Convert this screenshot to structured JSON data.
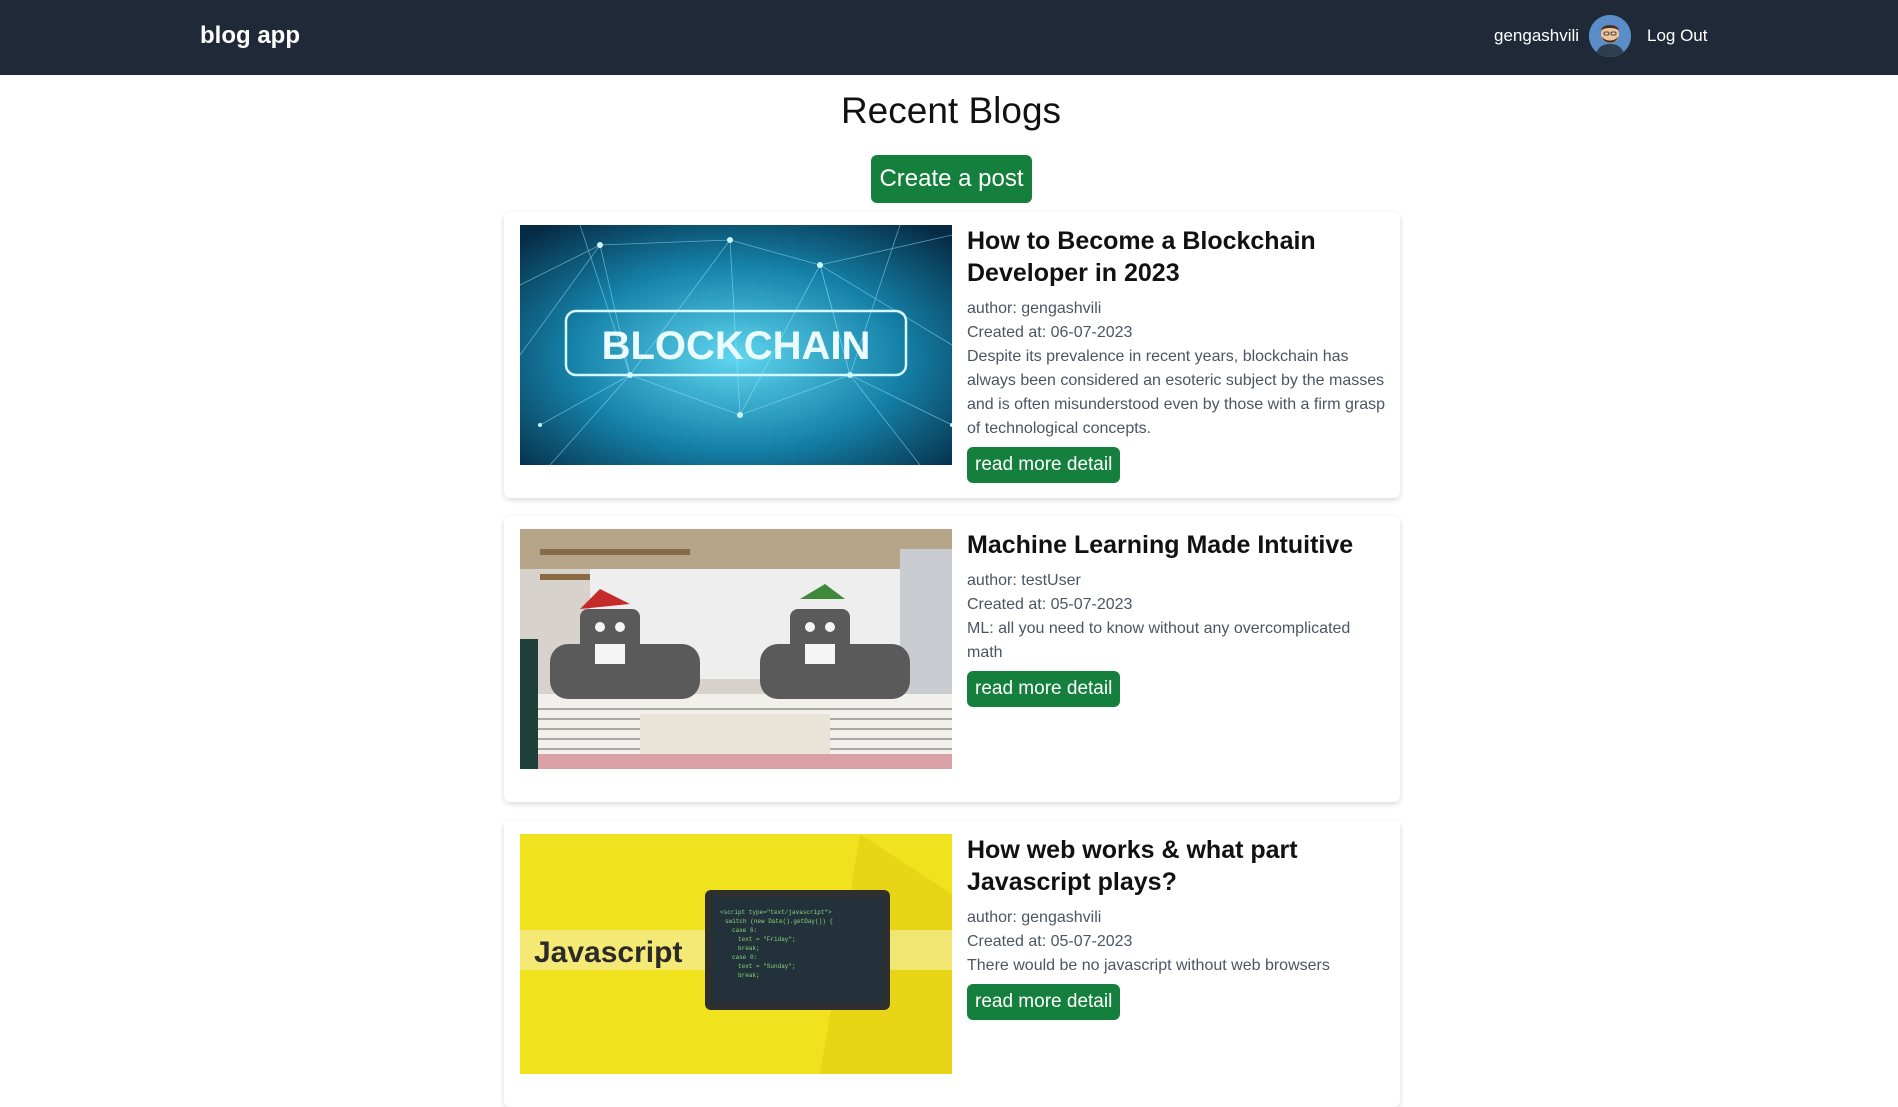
{
  "navbar": {
    "brand": "blog app",
    "username": "gengashvili",
    "avatar_icon": "user-avatar-icon",
    "logout_label": "Log Out",
    "background": "#1f2937"
  },
  "main": {
    "title": "Recent Blogs",
    "create_label": "Create a post",
    "accent": "#15803d"
  },
  "posts": [
    {
      "title": "How to Become a Blockchain Developer in 2023",
      "author": "author: gengashvili",
      "created": "Created at: 06-07-2023",
      "excerpt": "Despite its prevalence in recent years, blockchain has always been considered an esoteric subject by the masses and is often misunderstood even by those with a firm grasp of technological concepts.",
      "button_label": "read more detail",
      "image_text": "BLOCKCHAIN"
    },
    {
      "title": "Machine Learning Made Intuitive",
      "author": "author: testUser",
      "created": "Created at: 05-07-2023",
      "excerpt": "ML: all you need to know without any overcomplicated math",
      "button_label": "read more detail",
      "image_text": ""
    },
    {
      "title": "How web works & what part Javascript plays?",
      "author": "author: gengashvili",
      "created": "Created at: 05-07-2023",
      "excerpt": "There would be no javascript without web browsers",
      "button_label": "read more detail",
      "image_text": "Javascript"
    }
  ]
}
